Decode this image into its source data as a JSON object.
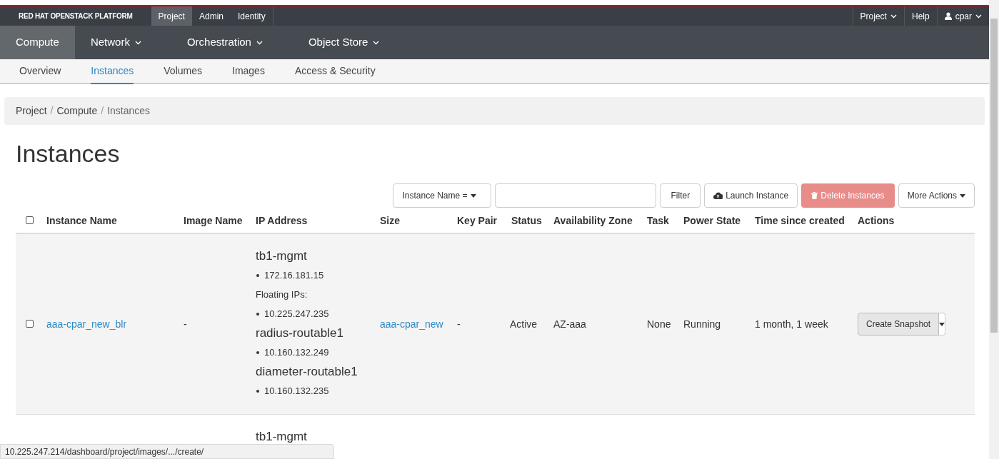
{
  "brand": "RED HAT OPENSTACK PLATFORM",
  "top_tabs": [
    {
      "label": "Project",
      "selected": true
    },
    {
      "label": "Admin",
      "selected": false
    },
    {
      "label": "Identity",
      "selected": false
    }
  ],
  "top_right": [
    {
      "label": "Project",
      "kind": "dropdown"
    },
    {
      "label": "Help",
      "kind": "link"
    },
    {
      "label": "cpar",
      "kind": "user"
    }
  ],
  "dashboards": [
    {
      "label": "Compute",
      "selected": true,
      "has_menu": false
    },
    {
      "label": "Network",
      "selected": false,
      "has_menu": true
    },
    {
      "label": "Orchestration",
      "selected": false,
      "has_menu": true
    },
    {
      "label": "Object Store",
      "selected": false,
      "has_menu": true
    }
  ],
  "sub_tabs": [
    {
      "label": "Overview",
      "selected": false
    },
    {
      "label": "Instances",
      "selected": true
    },
    {
      "label": "Volumes",
      "selected": false
    },
    {
      "label": "Images",
      "selected": false
    },
    {
      "label": "Access & Security",
      "selected": false
    }
  ],
  "breadcrumb": [
    {
      "kind": "link",
      "text": "Project"
    },
    {
      "kind": "separator",
      "text": "/"
    },
    {
      "kind": "link",
      "text": "Compute"
    },
    {
      "kind": "separator",
      "text": "/"
    },
    {
      "kind": "current",
      "text": "Instances"
    }
  ],
  "page_title": "Instances",
  "toolbar": {
    "filter_select": "Instance Name =",
    "filter_button": "Filter",
    "launch_button": "Launch Instance",
    "delete_button": {
      "label": "Delete Instances",
      "disabled": true
    },
    "more_button": "More Actions"
  },
  "table": {
    "select_all": {
      "checked": false
    },
    "columns": [
      "Instance Name",
      "Image Name",
      "IP Address",
      "Size",
      "Key Pair",
      "Status",
      "Availability Zone",
      "Task",
      "Power State",
      "Time since created",
      "Actions"
    ],
    "rows": [
      {
        "checked": false,
        "name": "aaa-cpar_new_blr",
        "image": "-",
        "networks": [
          {
            "name": "tb1-mgmt",
            "items": [
              {
                "kind": "ip",
                "text": "172.16.181.15"
              },
              {
                "kind": "label",
                "text": "Floating IPs:"
              },
              {
                "kind": "ip",
                "text": "10.225.247.235"
              }
            ]
          },
          {
            "name": "radius-routable1",
            "items": [
              {
                "kind": "ip",
                "text": "10.160.132.249"
              }
            ]
          },
          {
            "name": "diameter-routable1",
            "items": [
              {
                "kind": "ip",
                "text": "10.160.132.235"
              }
            ]
          }
        ],
        "size": "aaa-cpar_new",
        "key_pair": "-",
        "status": "Active",
        "zone": "AZ-aaa",
        "task": "None",
        "power": "Running",
        "age": "1 month, 1 week",
        "action": "Create Snapshot"
      },
      {
        "networks": [
          {
            "name": "tb1-mgmt"
          }
        ]
      }
    ]
  },
  "status_url": "10.225.247.214/dashboard/project/images/.../create/"
}
